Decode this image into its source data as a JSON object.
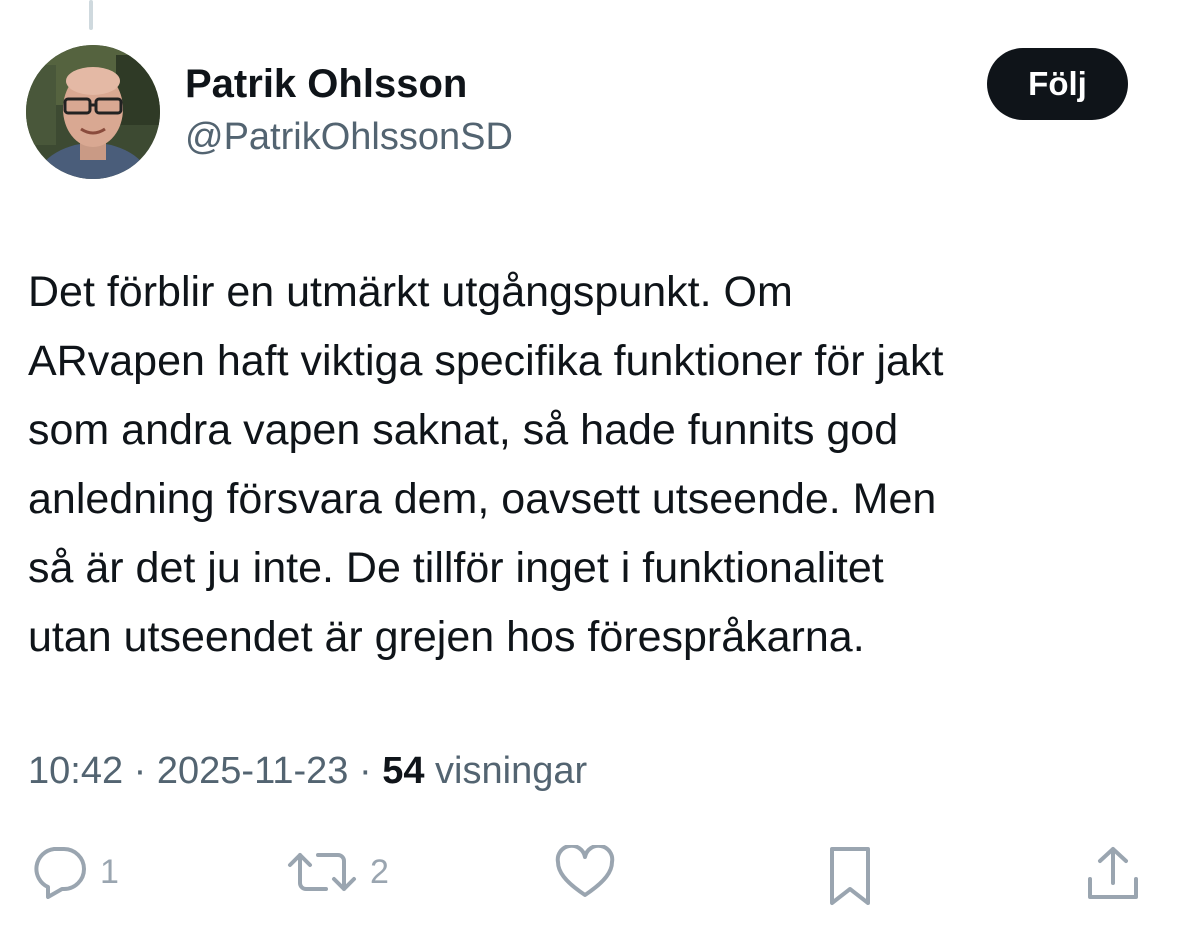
{
  "author": {
    "name": "Patrik Ohlsson",
    "handle": "@PatrikOhlssonSD"
  },
  "follow_button": {
    "label": "Följ"
  },
  "tweet": {
    "lines": [
      "Det förblir en utmärkt utgångspunkt. Om",
      "ARvapen haft viktiga specifika funktioner för jakt",
      "som andra vapen saknat, så hade funnits god",
      "anledning försvara dem, oavsett utseende. Men",
      "så är det ju inte. ",
      "De tillför inget i funktionalitet",
      "utan utseendet är grejen hos förespråkarna."
    ],
    "highlight_color": "#fbf724"
  },
  "meta": {
    "time": "10:42",
    "separator": " · ",
    "date": "2025-11-23",
    "views_count": "54",
    "views_label": " visningar"
  },
  "actions": {
    "reply": {
      "icon": "reply-icon",
      "count": "1"
    },
    "retweet": {
      "icon": "retweet-icon",
      "count": "2"
    },
    "like": {
      "icon": "heart-icon",
      "count": ""
    },
    "bookmark": {
      "icon": "bookmark-icon",
      "count": ""
    },
    "share": {
      "icon": "share-icon",
      "count": ""
    }
  },
  "colors": {
    "text": "#0f1419",
    "secondary": "#536471",
    "action_icons": "#9aa5b0"
  }
}
